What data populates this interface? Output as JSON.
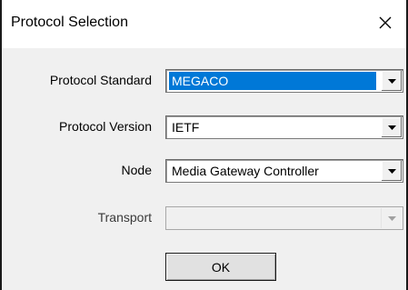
{
  "window": {
    "title": "Protocol Selection",
    "close_icon": "close-icon"
  },
  "form": {
    "protocol_standard": {
      "label": "Protocol Standard",
      "value": "MEGACO",
      "selected_highlight": "#0078d7"
    },
    "protocol_version": {
      "label": "Protocol Version",
      "value": "IETF"
    },
    "node": {
      "label": "Node",
      "value": "Media Gateway Controller"
    },
    "transport": {
      "label": "Transport",
      "value": "",
      "disabled": true
    }
  },
  "actions": {
    "ok_label": "OK"
  }
}
